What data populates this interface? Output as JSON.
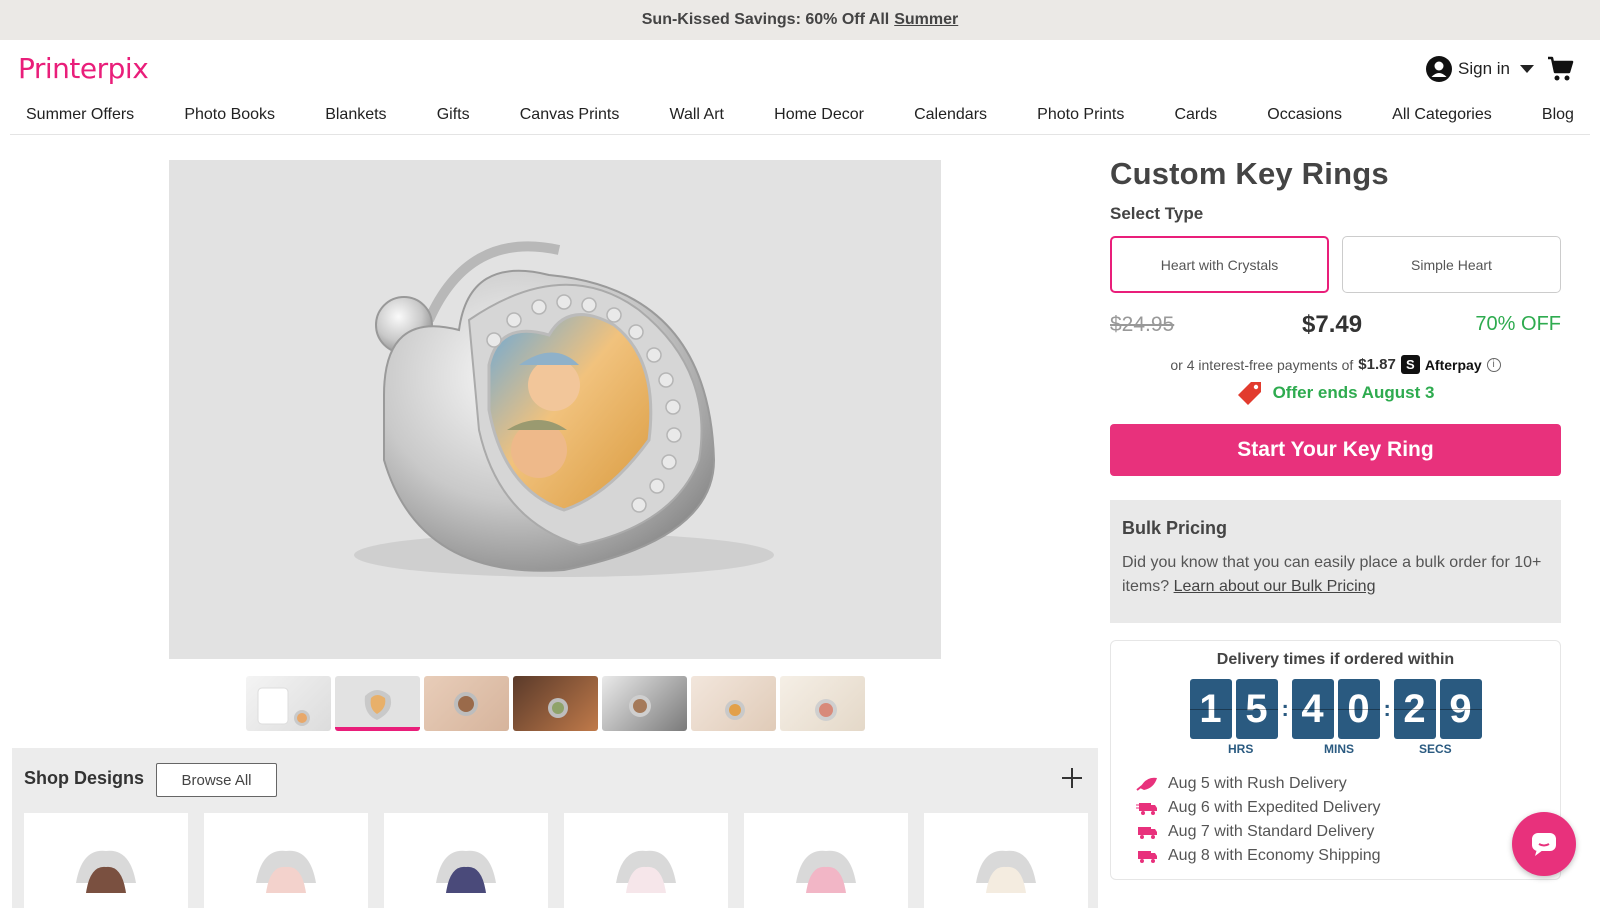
{
  "promo": {
    "text": "Sun-Kissed Savings: 60% Off All",
    "link": "Summer"
  },
  "header": {
    "logo": "Printerpix",
    "sign_in": "Sign in"
  },
  "nav": [
    "Summer Offers",
    "Photo Books",
    "Blankets",
    "Gifts",
    "Canvas Prints",
    "Wall Art",
    "Home Decor",
    "Calendars",
    "Photo Prints",
    "Cards",
    "Occasions",
    "All Categories",
    "Blog"
  ],
  "product": {
    "title": "Custom Key Rings",
    "select_type_label": "Select Type",
    "types": [
      "Heart with Crystals",
      "Simple Heart"
    ],
    "old_price": "$24.95",
    "price": "$7.49",
    "discount": "70% OFF",
    "afterpay_prefix": "or 4 interest-free payments of",
    "afterpay_amount": "$1.87",
    "afterpay_brand": "Afterpay",
    "offer_text": "Offer ends August 3",
    "cta": "Start Your Key Ring"
  },
  "bulk": {
    "title": "Bulk Pricing",
    "text": "Did you know that you can easily place a bulk order for 10+ items?",
    "link": "Learn about our Bulk Pricing"
  },
  "delivery": {
    "title": "Delivery times if ordered within",
    "digits": [
      "1",
      "5",
      "4",
      "0",
      "2",
      "9"
    ],
    "labels": [
      "HRS",
      "MINS",
      "SECS"
    ],
    "options": [
      "Aug 5 with Rush Delivery",
      "Aug 6 with Expedited Delivery",
      "Aug 7 with Standard Delivery",
      "Aug 8 with Economy Shipping"
    ]
  },
  "shop": {
    "title": "Shop Designs",
    "browse": "Browse All"
  },
  "colors": {
    "brand": "#e91e7a",
    "cta": "#e8317c",
    "green": "#2eab4f",
    "timer": "#2a5a80"
  }
}
